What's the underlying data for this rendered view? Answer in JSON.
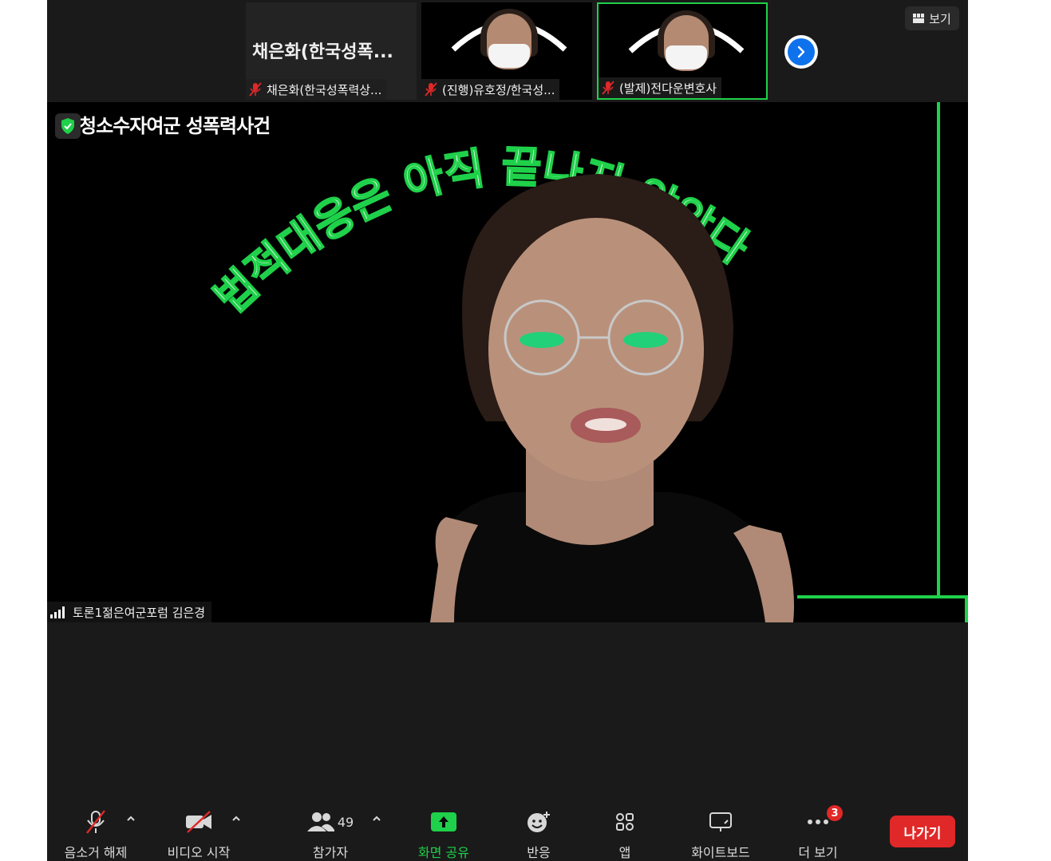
{
  "strip": {
    "tiles": [
      {
        "big_name": "채은화(한국성폭...",
        "label": "채은화(한국성폭력상...",
        "muted": true
      },
      {
        "label": "(진행)유호정/한국성...",
        "muted": true
      },
      {
        "label": "(발제)전다운변호사",
        "muted": true
      }
    ],
    "next_icon": "chevron-right-icon",
    "view_label": "보기"
  },
  "main": {
    "slide_subtitle": "청소수자여군 성폭력사건",
    "slide_headline": "법적대응은 아직 끝나지 않았다",
    "speaker_label": "토론1젊은여군포럼 김은경",
    "accent_color": "#1fd14a"
  },
  "toolbar": {
    "unmute_label": "음소거 해제",
    "video_label": "비디오 시작",
    "participants_label": "참가자",
    "participants_count": "49",
    "share_label": "화면 공유",
    "reactions_label": "반응",
    "apps_label": "앱",
    "whiteboard_label": "화이트보드",
    "more_label": "더 보기",
    "more_badge": "3",
    "leave_label": "나가기",
    "share_color": "#1fd14a",
    "leave_color": "#e02828"
  }
}
